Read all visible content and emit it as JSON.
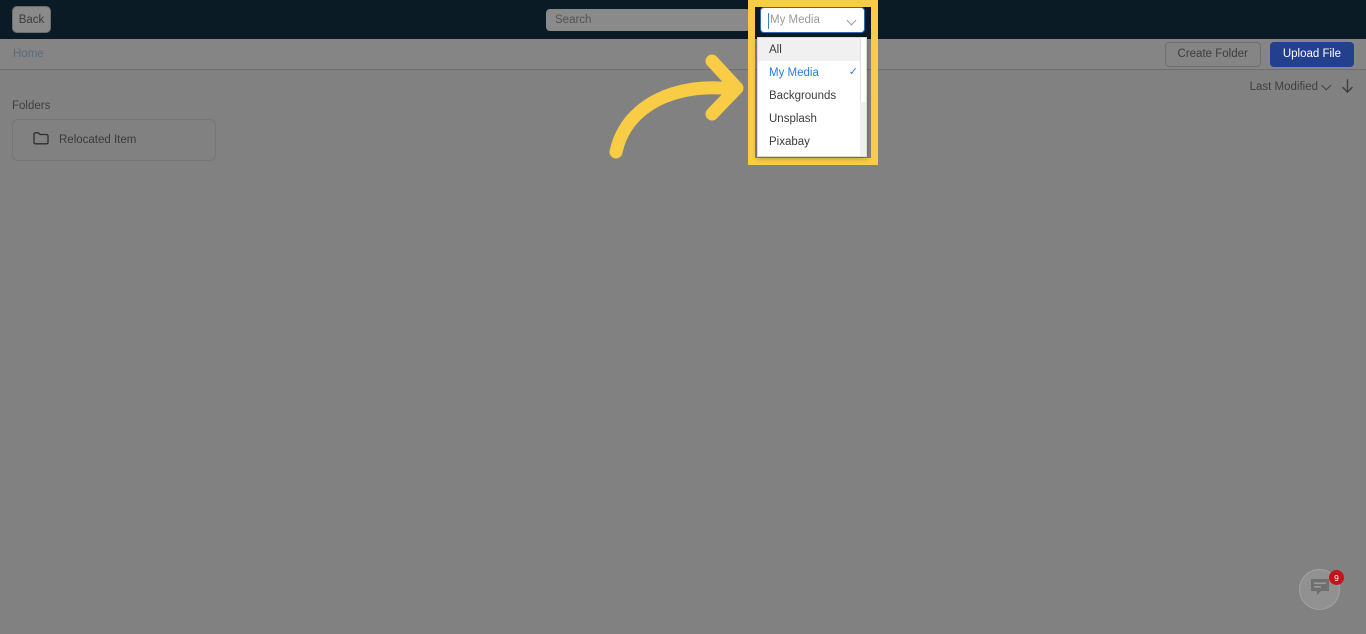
{
  "header": {
    "back_label": "Back",
    "search_placeholder": "Search",
    "search_value": ""
  },
  "media_select": {
    "value": "My Media",
    "chevron_icon": "chevron-down-icon",
    "options": [
      {
        "label": "All",
        "selected": false,
        "hovered": true
      },
      {
        "label": "My Media",
        "selected": true,
        "hovered": false
      },
      {
        "label": "Backgrounds",
        "selected": false,
        "hovered": false
      },
      {
        "label": "Unsplash",
        "selected": false,
        "hovered": false
      },
      {
        "label": "Pixabay",
        "selected": false,
        "hovered": false
      }
    ],
    "check_glyph": "✓"
  },
  "breadcrumb": {
    "items": [
      "Home"
    ],
    "create_folder_label": "Create Folder",
    "upload_file_label": "Upload File"
  },
  "sort": {
    "label": "Last Modified",
    "chevron_icon": "chevron-down-icon",
    "direction_icon": "arrow-down-icon"
  },
  "content": {
    "folders_label": "Folders",
    "folders": [
      {
        "name": "Relocated Item",
        "icon": "folder-icon"
      }
    ]
  },
  "chat": {
    "icon": "chat-bubble-icon",
    "badge": "9"
  },
  "annotation": {
    "arrow_icon": "curved-arrow-right-icon",
    "highlight_color": "#f9cc46"
  },
  "colors": {
    "header_bg": "#0a1b25",
    "body_bg": "#818181",
    "primary_button": "#23408e",
    "accent_highlight": "#f9cc46",
    "select_focus": "#2b6cb8",
    "selected_option": "#2f7ae5"
  }
}
